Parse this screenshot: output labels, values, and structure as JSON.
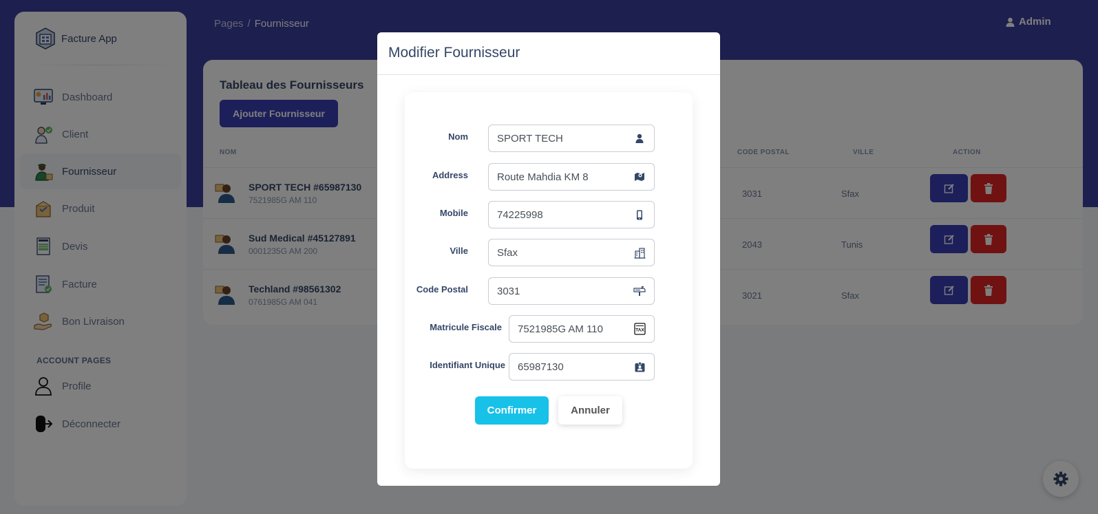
{
  "breadcrumb": {
    "root": "Pages",
    "separator": "/",
    "current": "Fournisseur"
  },
  "header": {
    "user_label": "Admin"
  },
  "sidebar": {
    "app_name": "Facture App",
    "items": [
      {
        "label": "Dashboard",
        "icon": "dashboard-icon"
      },
      {
        "label": "Client",
        "icon": "client-icon"
      },
      {
        "label": "Fournisseur",
        "icon": "supplier-icon",
        "active": true
      },
      {
        "label": "Produit",
        "icon": "product-icon"
      },
      {
        "label": "Devis",
        "icon": "quote-icon"
      },
      {
        "label": "Facture",
        "icon": "invoice-icon"
      },
      {
        "label": "Bon Livraison",
        "icon": "delivery-icon"
      }
    ],
    "section_title": "ACCOUNT PAGES",
    "account_items": [
      {
        "label": "Profile",
        "icon": "profile-icon"
      },
      {
        "label": "Déconnecter",
        "icon": "logout-icon"
      }
    ]
  },
  "main": {
    "card_title": "Tableau des Fournisseurs",
    "add_button": "Ajouter Fournisseur",
    "columns": [
      "NOM",
      "CODE POSTAL",
      "VILLE",
      "ACTION"
    ],
    "rows": [
      {
        "name": "SPORT TECH #65987130",
        "sub": "7521985G AM 110",
        "code_postal": "3031",
        "ville": "Sfax"
      },
      {
        "name": "Sud Medical #45127891",
        "sub": "0001235G AM 200",
        "code_postal": "2043",
        "ville": "Tunis"
      },
      {
        "name": "Techland #98561302",
        "sub": "0761985G AM 041",
        "code_postal": "3021",
        "ville": "Sfax"
      }
    ]
  },
  "modal": {
    "title": "Modifier Fournisseur",
    "fields": [
      {
        "label": "Nom",
        "value": "SPORT TECH",
        "icon": "user-icon"
      },
      {
        "label": "Address",
        "value": "Route Mahdia KM 8",
        "icon": "map-icon"
      },
      {
        "label": "Mobile",
        "value": "74225998",
        "icon": "mobile-icon"
      },
      {
        "label": "Ville",
        "value": "Sfax",
        "icon": "city-icon"
      },
      {
        "label": "Code Postal",
        "value": "3031",
        "icon": "mailbox-icon"
      },
      {
        "label": "Matricule Fiscale",
        "value": "7521985G AM 110",
        "icon": "tax-icon"
      },
      {
        "label": "Identifiant Unique",
        "value": "65987130",
        "icon": "id-badge-icon"
      }
    ],
    "confirm_label": "Confirmer",
    "cancel_label": "Annuler"
  },
  "colors": {
    "primary": "#3b3fb5",
    "danger": "#e02424",
    "info": "#17c1e8",
    "header_band": "#3a3f9f"
  }
}
